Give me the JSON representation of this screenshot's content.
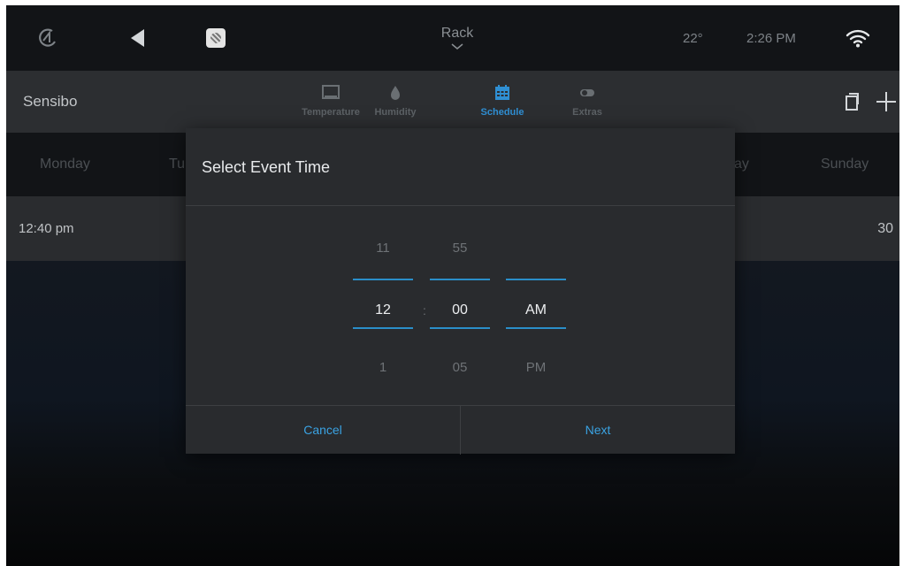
{
  "statusbar": {
    "room": "Rack",
    "temperature": "22°",
    "time": "2:26 PM"
  },
  "header": {
    "app_title": "Sensibo",
    "tabs": [
      {
        "label": "Temperature",
        "icon": "monitor-icon"
      },
      {
        "label": "Humidity",
        "icon": "droplet-icon"
      },
      {
        "label": "Schedule",
        "icon": "calendar-icon",
        "active": true
      },
      {
        "label": "Extras",
        "icon": "toggle-icon"
      }
    ]
  },
  "days": {
    "monday": "Monday",
    "tuesday_partial": "Tu",
    "saturday_partial": "ay",
    "sunday": "Sunday"
  },
  "event": {
    "time": "12:40 pm",
    "right_value": "30"
  },
  "dialog": {
    "title": "Select Event Time",
    "hour": {
      "prev": "11",
      "current": "12",
      "next": "1"
    },
    "minute": {
      "prev": "55",
      "current": "00",
      "next": "05"
    },
    "ampm": {
      "current": "AM",
      "next": "PM"
    },
    "separator": ":",
    "cancel_label": "Cancel",
    "next_label": "Next"
  },
  "colors": {
    "accent": "#2f8fd3",
    "dialog_bg": "#292b2e",
    "header_bg": "#2c2e31",
    "statusbar_bg": "#121417"
  }
}
